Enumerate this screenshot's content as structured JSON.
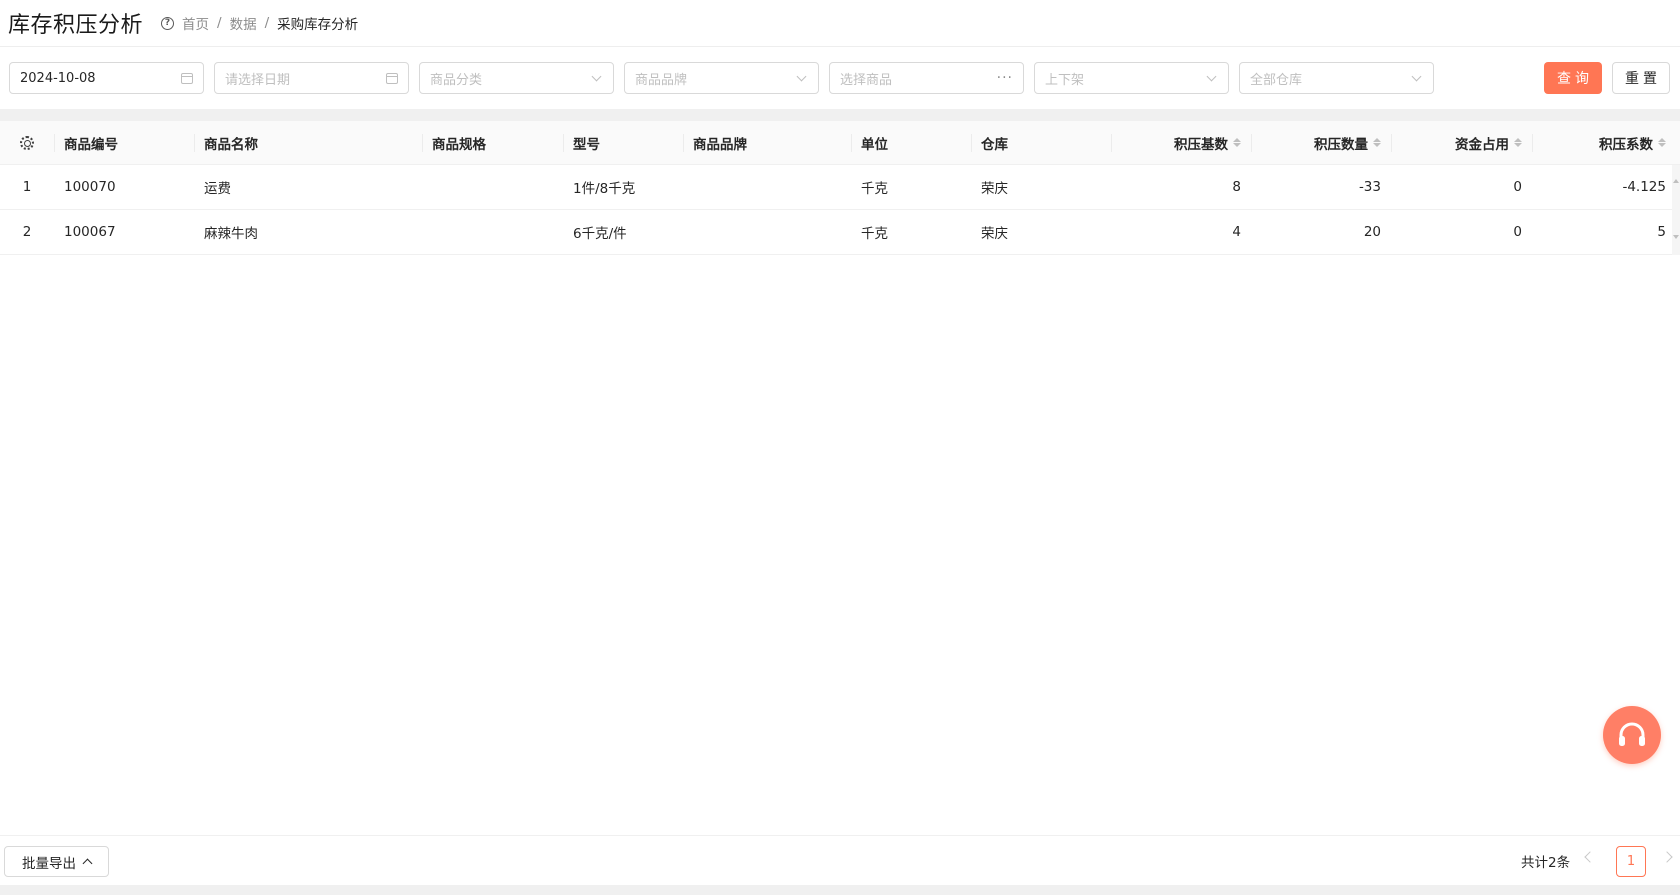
{
  "header": {
    "title": "库存积压分析",
    "breadcrumb": [
      "首页",
      "数据",
      "采购库存分析"
    ],
    "separator": "/"
  },
  "filters": {
    "start_date": "2024-10-08",
    "end_date_placeholder": "请选择日期",
    "category_placeholder": "商品分类",
    "brand_placeholder": "商品品牌",
    "product_placeholder": "选择商品",
    "shelf_placeholder": "上下架",
    "warehouse_placeholder": "全部仓库",
    "query_label": "查询",
    "reset_label": "重置"
  },
  "table": {
    "columns": [
      "商品编号",
      "商品名称",
      "商品规格",
      "型号",
      "商品品牌",
      "单位",
      "仓库",
      "积压基数",
      "积压数量",
      "资金占用",
      "积压系数"
    ],
    "rows": [
      {
        "index": "1",
        "code": "100070",
        "name": "运费",
        "spec": "",
        "model": "1件/8千克",
        "brand": "",
        "unit": "千克",
        "warehouse": "荣庆",
        "base": "8",
        "qty": "-33",
        "funds": "0",
        "coef": "-4.125"
      },
      {
        "index": "2",
        "code": "100067",
        "name": "麻辣牛肉",
        "spec": "",
        "model": "6千克/件",
        "brand": "",
        "unit": "千克",
        "warehouse": "荣庆",
        "base": "4",
        "qty": "20",
        "funds": "0",
        "coef": "5"
      }
    ]
  },
  "footer": {
    "export_label": "批量导出",
    "total_text": "共计2条",
    "current_page": "1"
  },
  "colors": {
    "accent": "#ff7654",
    "support": "#ff7f66"
  }
}
